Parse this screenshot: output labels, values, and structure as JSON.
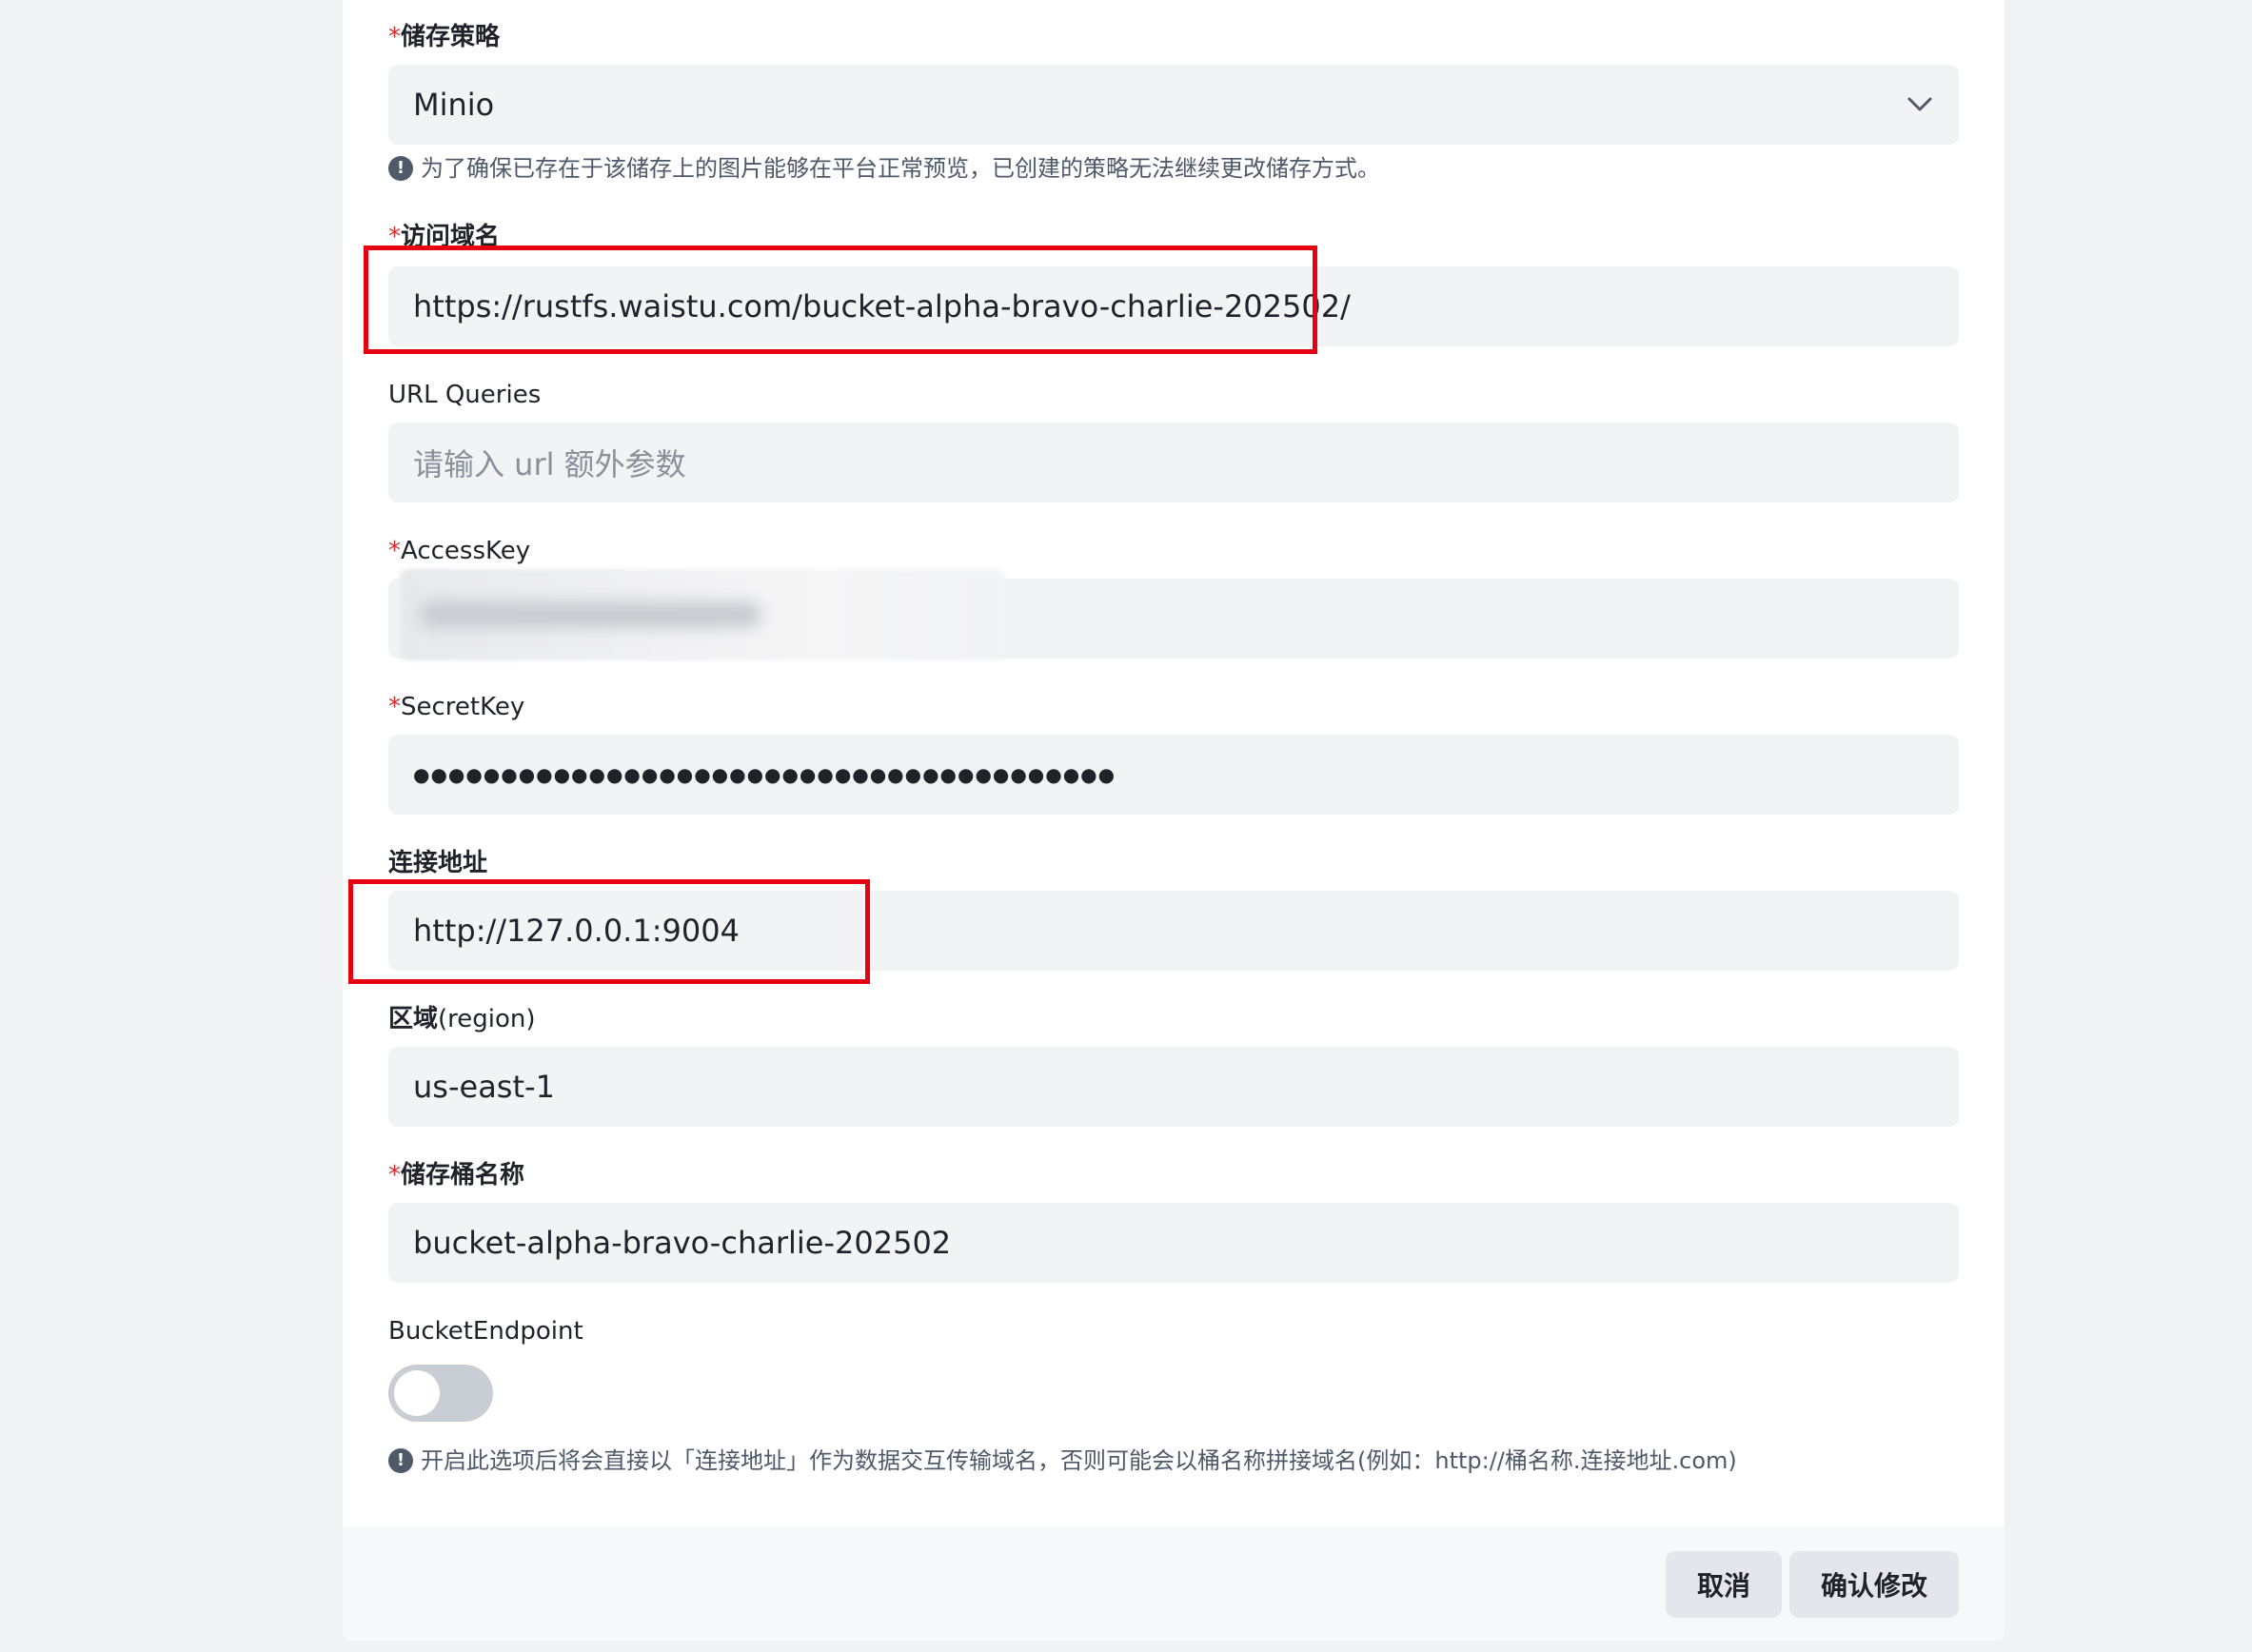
{
  "form": {
    "storage_policy": {
      "label": "储存策略",
      "value": "Minio",
      "hint": "为了确保已存在于该储存上的图片能够在平台正常预览，已创建的策略无法继续更改储存方式。"
    },
    "access_domain": {
      "label": "访问域名",
      "value": "https://rustfs.waistu.com/bucket-alpha-bravo-charlie-202502/"
    },
    "url_queries": {
      "label": "URL Queries",
      "placeholder": "请输入 url 额外参数"
    },
    "access_key": {
      "label": "AccessKey"
    },
    "secret_key": {
      "label": "SecretKey",
      "value": "●●●●●●●●●●●●●●●●●●●●●●●●●●●●●●●●●●●●●●●●"
    },
    "endpoint": {
      "label": "连接地址",
      "value": "http://127.0.0.1:9004"
    },
    "region": {
      "label_main": "区域",
      "label_sub": "(region)",
      "value": "us-east-1"
    },
    "bucket_name": {
      "label": "储存桶名称",
      "value": "bucket-alpha-bravo-charlie-202502"
    },
    "bucket_endpoint": {
      "label": "BucketEndpoint",
      "enabled": false,
      "hint": "开启此选项后将会直接以「连接地址」作为数据交互传输域名，否则可能会以桶名称拼接域名(例如：http://桶名称.连接地址.com)"
    },
    "required_mark": "*"
  },
  "footer": {
    "cancel_label": "取消",
    "confirm_label": "确认修改"
  },
  "colors": {
    "highlight": "#e60012",
    "field_bg": "#f2f3f5",
    "required": "#e02b2b"
  }
}
